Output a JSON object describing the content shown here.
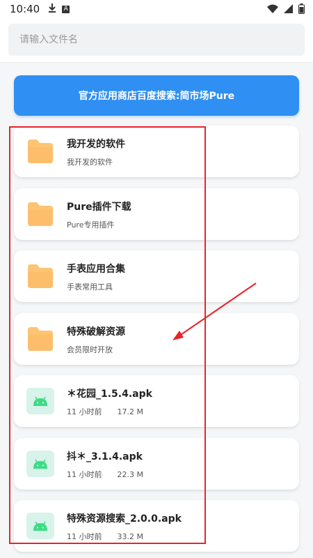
{
  "status_bar": {
    "time": "10:40",
    "icons": [
      "download-icon",
      "a-notification-icon",
      "wifi-icon",
      "signal-icon",
      "battery-icon"
    ]
  },
  "search": {
    "placeholder": "请输入文件名"
  },
  "banner": {
    "label": "官方应用商店百度搜索:简市场Pure",
    "color": "#2f8ff2"
  },
  "files": [
    {
      "type": "folder",
      "title": "我开发的软件",
      "subtitle": "我开发的软件"
    },
    {
      "type": "folder",
      "title": "Pure插件下载",
      "subtitle": "Pure专用插件"
    },
    {
      "type": "folder",
      "title": "手表应用合集",
      "subtitle": "手表常用工具"
    },
    {
      "type": "folder",
      "title": "特殊破解资源",
      "subtitle": "会员限时开放"
    },
    {
      "type": "apk",
      "title": "＊花园_1.5.4.apk",
      "time": "11 小时前",
      "size": "17.2 M"
    },
    {
      "type": "apk",
      "title": "抖＊_3.1.4.apk",
      "time": "11 小时前",
      "size": "22.3 M"
    },
    {
      "type": "apk",
      "title": "特殊资源搜索_2.0.0.apk",
      "time": "11 小时前",
      "size": "33.2 M"
    }
  ],
  "colors": {
    "folder": "#fdc474",
    "android": "#3ddc84",
    "annotation": "#e8232a"
  }
}
